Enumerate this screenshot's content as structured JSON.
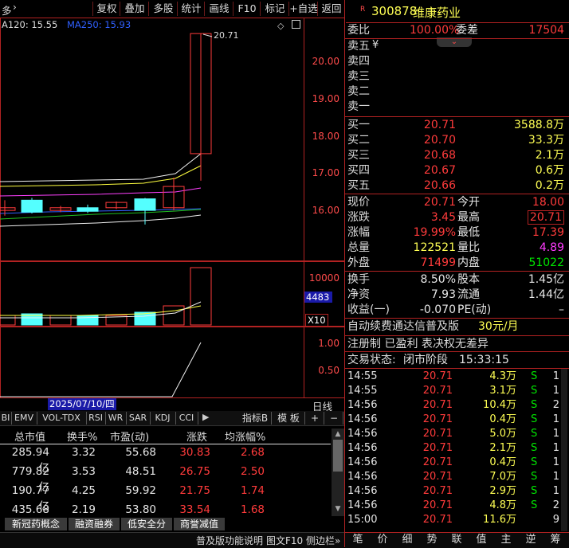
{
  "toolbar": {
    "left_label": "多",
    "buttons": [
      "复权",
      "叠加",
      "多股",
      "统计",
      "画线",
      "F10",
      "标记",
      "+自选",
      "返回"
    ]
  },
  "chart": {
    "ma_label_1": "A120: 15.55",
    "ma_label_2": "MA250: 15.93",
    "high_annotation": "20.71",
    "price_ticks": [
      "20.00",
      "19.00",
      "18.00",
      "17.00",
      "16.00"
    ],
    "volume_ticks": [
      "10000"
    ],
    "volume_marker": "4483",
    "volume_unit": "X10",
    "indicator_ticks": [
      "1.00",
      "0.50"
    ],
    "date_label": "2025/07/10/四",
    "dayline_label": "日线"
  },
  "chart_data": {
    "type": "candlestick",
    "price_axis": [
      15.5,
      21.0
    ],
    "candles": [
      {
        "open": 16.78,
        "close": 16.72,
        "high": 16.95,
        "low": 16.6,
        "color": "red"
      },
      {
        "open": 16.95,
        "close": 16.68,
        "high": 17.0,
        "low": 16.65,
        "color": "cyan"
      },
      {
        "open": 16.72,
        "close": 16.78,
        "high": 16.82,
        "low": 16.68,
        "color": "red"
      },
      {
        "open": 16.78,
        "close": 16.7,
        "high": 16.85,
        "low": 16.66,
        "color": "cyan"
      },
      {
        "open": 16.78,
        "close": 16.9,
        "high": 16.92,
        "low": 16.75,
        "color": "red"
      },
      {
        "open": 16.98,
        "close": 16.72,
        "high": 17.0,
        "low": 16.4,
        "color": "cyan"
      },
      {
        "open": 16.78,
        "close": 17.26,
        "high": 17.46,
        "low": 16.72,
        "color": "red"
      },
      {
        "open": 18.0,
        "close": 20.71,
        "high": 20.71,
        "low": 17.39,
        "color": "red"
      }
    ]
  },
  "indicator_tabs": [
    "BI",
    "EMV",
    "VOL-TDX",
    "RSI",
    "WR",
    "SAR",
    "KDJ",
    "CCI"
  ],
  "indicator_right": [
    "指标B",
    "模 板",
    "+",
    "−"
  ],
  "table": {
    "headers": [
      "总市值",
      "换手%",
      "市盈(动)",
      "涨跌",
      "均涨幅%"
    ],
    "rows": [
      [
        "285.94亿",
        "3.32",
        "55.68",
        "30.83",
        "2.68"
      ],
      [
        "779.82亿",
        "3.53",
        "48.51",
        "26.75",
        "2.50"
      ],
      [
        "190.77亿",
        "4.25",
        "59.92",
        "21.75",
        "1.74"
      ],
      [
        "435.68亿",
        "2.19",
        "53.80",
        "33.54",
        "1.68"
      ]
    ]
  },
  "bottom_tabs": [
    "新冠药概念",
    "融资融券",
    "低安全分",
    "商誉减值"
  ],
  "status_bar": {
    "hint": "普及版功能说明",
    "f10": "图文F10",
    "side": "侧边栏»"
  },
  "stock": {
    "code": "300878",
    "name": "维康药业",
    "ratio_label": "委比",
    "ratio_value": "100.00%",
    "diff_label": "委差",
    "diff_value": "17504",
    "sell": [
      {
        "label": "卖五",
        "price": "",
        "vol": ""
      },
      {
        "label": "卖四",
        "price": "",
        "vol": ""
      },
      {
        "label": "卖三",
        "price": "",
        "vol": ""
      },
      {
        "label": "卖二",
        "price": "",
        "vol": ""
      },
      {
        "label": "卖一",
        "price": "",
        "vol": ""
      }
    ],
    "buy": [
      {
        "label": "买一",
        "price": "20.71",
        "vol": "3588.8万"
      },
      {
        "label": "买二",
        "price": "20.70",
        "vol": "33.3万"
      },
      {
        "label": "买三",
        "price": "20.68",
        "vol": "2.1万"
      },
      {
        "label": "买四",
        "price": "20.67",
        "vol": "0.6万"
      },
      {
        "label": "买五",
        "price": "20.66",
        "vol": "0.2万"
      }
    ],
    "quote": [
      {
        "l1": "现价",
        "v1": "20.71",
        "l2": "今开",
        "v2": "18.00"
      },
      {
        "l1": "涨跌",
        "v1": "3.45",
        "l2": "最高",
        "v2": "20.71"
      },
      {
        "l1": "涨幅",
        "v1": "19.99%",
        "l2": "最低",
        "v2": "17.39"
      },
      {
        "l1": "总量",
        "v1": "122521",
        "l2": "量比",
        "v2": "4.89"
      },
      {
        "l1": "外盘",
        "v1": "71499",
        "l2": "内盘",
        "v2": "51022"
      }
    ],
    "fund": [
      {
        "l1": "换手",
        "v1": "8.50%",
        "l2": "股本",
        "v2": "1.45亿"
      },
      {
        "l1": "净资",
        "v1": "7.93",
        "l2": "流通",
        "v2": "1.44亿"
      },
      {
        "l1": "收益(一)",
        "v1": "-0.070",
        "l2": "PE(动)",
        "v2": "–"
      }
    ],
    "promo": "自动续费通达信普及版",
    "promo_price": "30元/月",
    "info": "注册制 已盈利 表决权无差异",
    "trade_status_label": "交易状态:",
    "trade_status": "闭市阶段",
    "trade_time": "15:33:15"
  },
  "ticks": [
    [
      "14:55",
      "20.71",
      "4.3万",
      "S",
      "1"
    ],
    [
      "14:55",
      "20.71",
      "3.1万",
      "S",
      "1"
    ],
    [
      "14:56",
      "20.71",
      "10.4万",
      "S",
      "2"
    ],
    [
      "14:56",
      "20.71",
      "0.4万",
      "S",
      "1"
    ],
    [
      "14:56",
      "20.71",
      "5.0万",
      "S",
      "1"
    ],
    [
      "14:56",
      "20.71",
      "2.1万",
      "S",
      "1"
    ],
    [
      "14:56",
      "20.71",
      "0.4万",
      "S",
      "1"
    ],
    [
      "14:56",
      "20.71",
      "7.0万",
      "S",
      "1"
    ],
    [
      "14:56",
      "20.71",
      "2.9万",
      "S",
      "1"
    ],
    [
      "14:56",
      "20.71",
      "4.8万",
      "S",
      "2"
    ],
    [
      "15:00",
      "20.71",
      "11.6万",
      "",
      "9"
    ]
  ],
  "bottom_nav": [
    "笔",
    "价",
    "细",
    "势",
    "联",
    "值",
    "主",
    "逆",
    "筹"
  ]
}
